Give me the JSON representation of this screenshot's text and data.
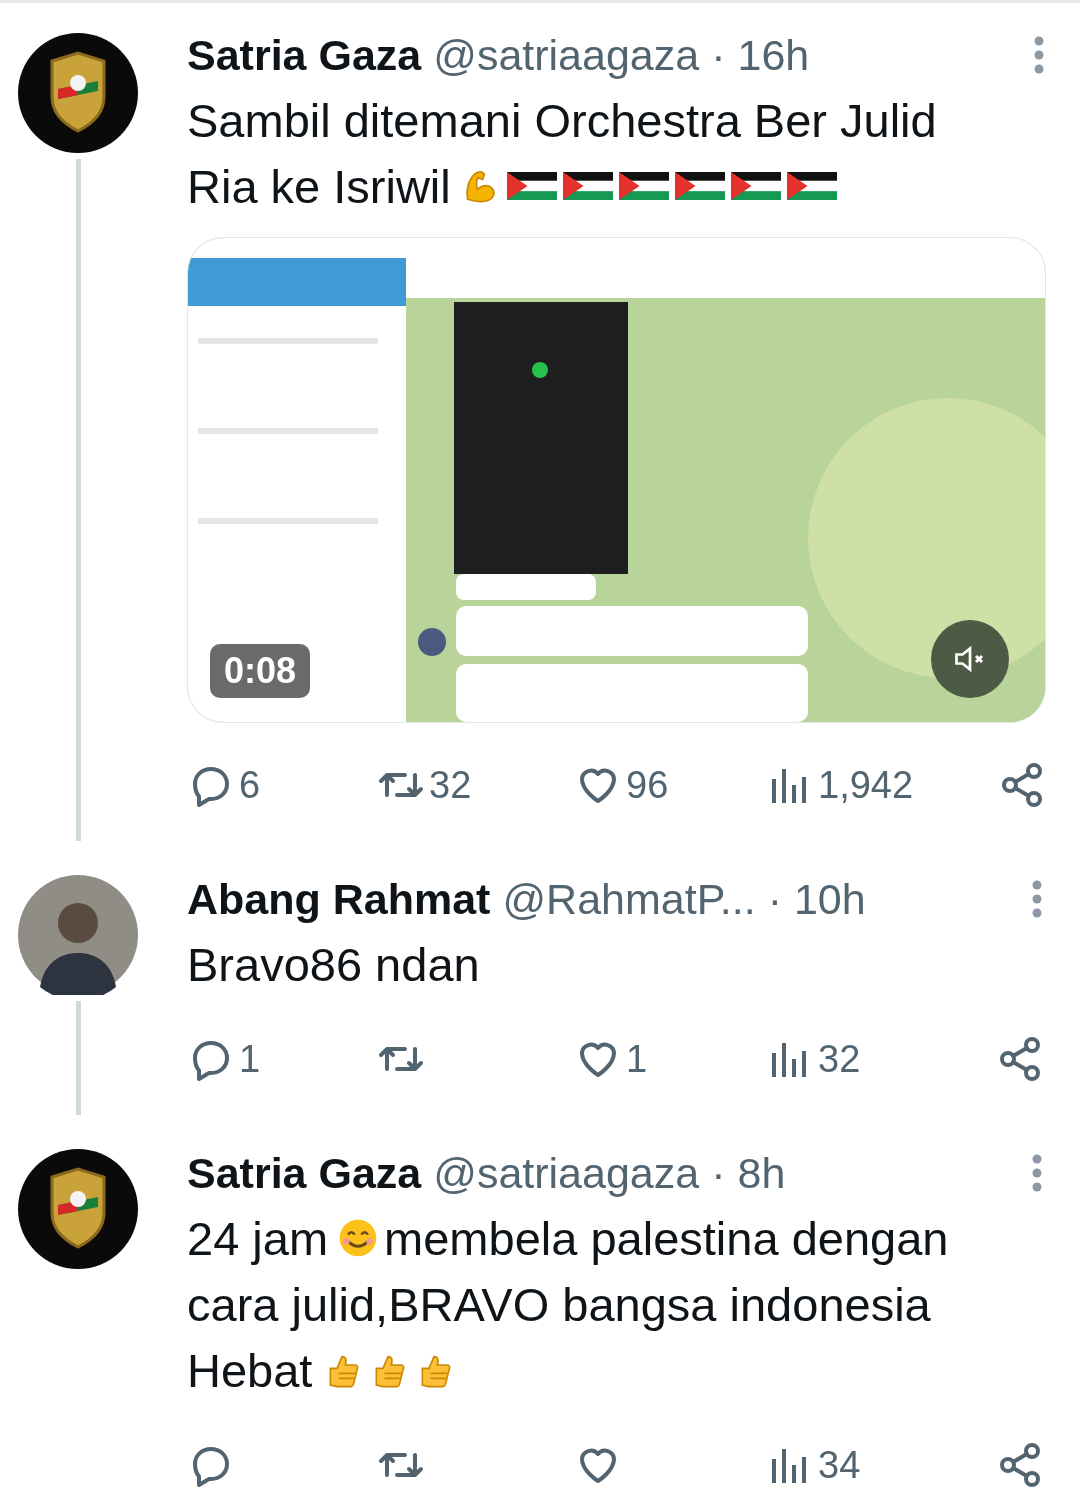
{
  "tweets": [
    {
      "avatar": {
        "kind": "logo"
      },
      "name": "Satria Gaza",
      "handle": "@satriaagaza",
      "time": "· 16h",
      "thread_line": true,
      "lines": [
        [
          {
            "kind": "text",
            "text": "Sambil ditemani Orchestra Ber Julid"
          }
        ],
        [
          {
            "kind": "text",
            "text": "Ria ke Isriwil"
          },
          {
            "kind": "muscle"
          },
          {
            "kind": "flag"
          },
          {
            "kind": "flag"
          },
          {
            "kind": "flag"
          },
          {
            "kind": "flag"
          },
          {
            "kind": "flag"
          },
          {
            "kind": "flag"
          }
        ]
      ],
      "media": {
        "kind": "picture",
        "duration": "0:08",
        "muted": true
      },
      "actions": {
        "replies": "6",
        "reposts": "32",
        "likes": "96",
        "views": "1,942"
      }
    },
    {
      "avatar": {
        "kind": "person"
      },
      "name": "Abang Rahmat",
      "handle": "@RahmatP...",
      "time": "· 10h",
      "thread_line": true,
      "lines": [
        [
          {
            "kind": "text",
            "text": "Bravo86 ndan"
          }
        ]
      ],
      "actions": {
        "replies": "1",
        "likes": "1",
        "views": "32"
      }
    },
    {
      "avatar": {
        "kind": "logo"
      },
      "name": "Satria Gaza",
      "handle": "@satriaagaza",
      "time": "· 8h",
      "thread_line": false,
      "lines": [
        [
          {
            "kind": "text",
            "text": "24 jam"
          },
          {
            "kind": "smile"
          },
          {
            "kind": "text",
            "text": "membela palestina dengan"
          }
        ],
        [
          {
            "kind": "text",
            "text": "cara julid,BRAVO bangsa indonesia"
          }
        ],
        [
          {
            "kind": "text",
            "text": "Hebat"
          },
          {
            "kind": "thumbs"
          },
          {
            "kind": "thumbs"
          },
          {
            "kind": "thumbs"
          }
        ]
      ],
      "actions": {
        "views": "34"
      }
    }
  ]
}
